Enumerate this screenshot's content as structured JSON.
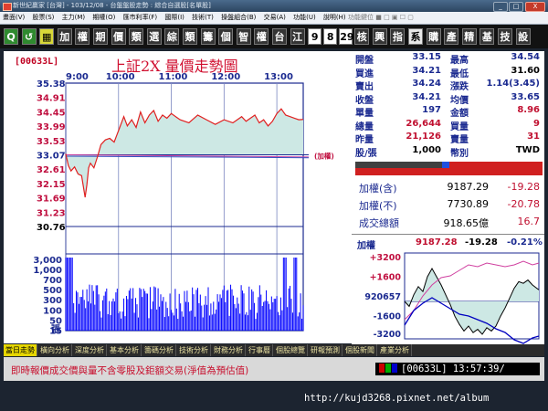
{
  "window": {
    "title": "新世紀贏家 [台灣] - 103/12/08 - 台盤盤股走勢 : 綜合自選股[名單股]",
    "buttons": {
      "minimize": "_",
      "maximize": "□",
      "close": "X"
    }
  },
  "menu": {
    "items": [
      "畫面(V)",
      "股票(S)",
      "主力(M)",
      "期權(O)",
      "匯市利率(F)",
      "國際(I)",
      "技術(T)",
      "操盤組合(B)",
      "交易(A)",
      "功能(U)",
      "說明(H)"
    ],
    "right": "功能鍵位  ■  □  ▣  ☐  ▢"
  },
  "toolbar": {
    "buttons": [
      {
        "label": "Q",
        "style": "g"
      },
      {
        "label": "↺",
        "style": "g"
      },
      {
        "label": "▦",
        "style": "y"
      },
      {
        "label": "加",
        "style": "k"
      },
      {
        "label": "權",
        "style": "k"
      },
      {
        "label": "期",
        "style": "k"
      },
      {
        "label": "價",
        "style": "k"
      },
      {
        "label": "類",
        "style": "k"
      },
      {
        "label": "選",
        "style": "k"
      },
      {
        "label": "綜",
        "style": "k"
      },
      {
        "label": "類",
        "style": "k"
      },
      {
        "label": "籌",
        "style": "k"
      },
      {
        "label": "個",
        "style": "k"
      },
      {
        "label": "智",
        "style": "k"
      },
      {
        "label": "權",
        "style": "k"
      },
      {
        "label": "台",
        "style": "k"
      },
      {
        "label": "江",
        "style": "k"
      },
      {
        "label": "9",
        "style": "n"
      },
      {
        "label": "8",
        "style": "n"
      },
      {
        "label": "29",
        "style": "n"
      },
      {
        "label": "核",
        "style": "k"
      },
      {
        "label": "興",
        "style": "k"
      },
      {
        "label": "指",
        "style": "k"
      },
      {
        "label": "系",
        "style": "w"
      },
      {
        "label": "購",
        "style": "k"
      },
      {
        "label": "產",
        "style": "k"
      },
      {
        "label": "精",
        "style": "k"
      },
      {
        "label": "基",
        "style": "k"
      },
      {
        "label": "技",
        "style": "k"
      },
      {
        "label": "設",
        "style": "k"
      }
    ]
  },
  "chart_panel": {
    "code": "[00633L]",
    "title": "上証2X  量價走勢圖",
    "secondary_label": "(加權)",
    "volume_unit": "張"
  },
  "quote": {
    "rows": [
      {
        "l1": "開盤",
        "v1": "33.15",
        "c1": "vb",
        "l2": "最高",
        "v2": "34.54",
        "c2": "vb"
      },
      {
        "l1": "買進",
        "v1": "34.21",
        "c1": "vb",
        "l2": "最低",
        "v2": "31.60",
        "c2": "vk"
      },
      {
        "l1": "賣出",
        "v1": "34.24",
        "c1": "vb",
        "l2": "漲跌",
        "v2": "1.14(3.45)",
        "c2": "vb"
      },
      {
        "l1": "收盤",
        "v1": "34.21",
        "c1": "vb",
        "l2": "均價",
        "v2": "33.65",
        "c2": "vb"
      },
      {
        "l1": "單量",
        "v1": "197",
        "c1": "vb",
        "l2": "金額",
        "v2": "8.96",
        "c2": "vr"
      },
      {
        "l1": "總量",
        "v1": "26,644",
        "c1": "vr",
        "l2": "買量",
        "v2": "9",
        "c2": "vr"
      },
      {
        "l1": "昨量",
        "v1": "21,126",
        "c1": "vr",
        "l2": "賣量",
        "v2": "31",
        "c2": "vr"
      },
      {
        "l1": "股/張",
        "v1": "1,000",
        "c1": "vk",
        "l2": "幣別",
        "v2": "TWD",
        "c2": "vk"
      }
    ]
  },
  "index_box": {
    "rows": [
      {
        "label": "加權(含)",
        "value": "9187.29",
        "change": "-19.28"
      },
      {
        "label": "加權(不)",
        "value": "7730.89",
        "change": "-20.78"
      },
      {
        "label": "成交總額",
        "value": "918.65億",
        "change": "16.7"
      }
    ]
  },
  "mini_chart": {
    "header_label": "加權",
    "header_value": "9187.28",
    "header_change": "-19.28",
    "header_pct": "-0.21%",
    "y_labels": [
      "+3200",
      "+1600",
      "920657",
      "-1600",
      "-3200"
    ],
    "y_label_colors": [
      "#c01040",
      "#c01040",
      "#1b2a90",
      "#1b2a90",
      "#1b2a90"
    ]
  },
  "tabs": [
    "當日走勢",
    "橫向分析",
    "深度分析",
    "基本分析",
    "籌碼分析",
    "技術分析",
    "財務分析",
    "行事曆",
    "個股總覽",
    "研報預測",
    "個股新聞",
    "產業分析"
  ],
  "status": {
    "message": "即時報價成交價與量不含零股及鉅額交易(淨值為預估值)",
    "code": "[00633L]",
    "time": "13:57:39/"
  },
  "watermark": "http://kujd3268.pixnet.net/album",
  "colors": {
    "accent_red": "#c8102e",
    "accent_blue": "#1b2a90",
    "price_fill": "#cde8e4",
    "volume_blue": "#0000ff"
  },
  "chart_data": {
    "type": "line",
    "title": "上証2X  量價走勢圖",
    "x_ticks": [
      "9:00",
      "10:00",
      "11:00",
      "12:00",
      "13:00"
    ],
    "price_axis_labels": [
      "35.38",
      "34.91",
      "34.45",
      "33.99",
      "33.53",
      "33.07",
      "32.61",
      "32.15",
      "31.69",
      "31.23",
      "30.76"
    ],
    "price_axis_colors": [
      "vb",
      "red",
      "red",
      "red",
      "red",
      "vb",
      "red",
      "red",
      "red",
      "red",
      "blk"
    ],
    "reference_price": 33.07,
    "ylim_price": [
      30.76,
      35.38
    ],
    "volume_axis_labels": [
      "3,000",
      "1,000",
      "700",
      "500",
      "300",
      "100",
      "50",
      "15"
    ],
    "price_series": {
      "name": "price",
      "x_minutes": [
        0,
        3,
        6,
        10,
        14,
        18,
        20,
        22,
        24,
        26,
        28,
        32,
        36,
        40,
        45,
        50,
        55,
        60,
        66,
        70,
        75,
        80,
        85,
        90,
        95,
        100,
        105,
        110,
        115,
        120,
        125,
        130,
        140,
        150,
        160,
        170,
        180,
        190,
        200,
        205,
        210,
        215,
        220,
        225,
        230,
        235,
        240,
        245,
        250,
        255,
        260,
        265,
        270
      ],
      "values": [
        33.1,
        32.72,
        32.55,
        32.68,
        32.45,
        32.4,
        32.05,
        31.7,
        32.1,
        32.65,
        32.8,
        32.65,
        33.0,
        33.4,
        33.55,
        33.6,
        33.48,
        33.85,
        34.3,
        34.0,
        34.2,
        33.95,
        34.45,
        34.1,
        34.35,
        34.5,
        34.15,
        34.35,
        34.25,
        34.4,
        34.3,
        34.2,
        34.1,
        34.35,
        34.2,
        34.05,
        34.2,
        34.1,
        34.3,
        34.15,
        34.25,
        34.35,
        34.1,
        34.2,
        34.0,
        34.15,
        34.4,
        34.55,
        34.35,
        34.3,
        34.25,
        34.2,
        34.21
      ]
    },
    "avg_series": {
      "name": "均價",
      "values_start": 33.07,
      "values_end": 33.0
    },
    "index_series": {
      "name": "加權",
      "values_start": 33.07,
      "values_end": 33.02
    }
  }
}
